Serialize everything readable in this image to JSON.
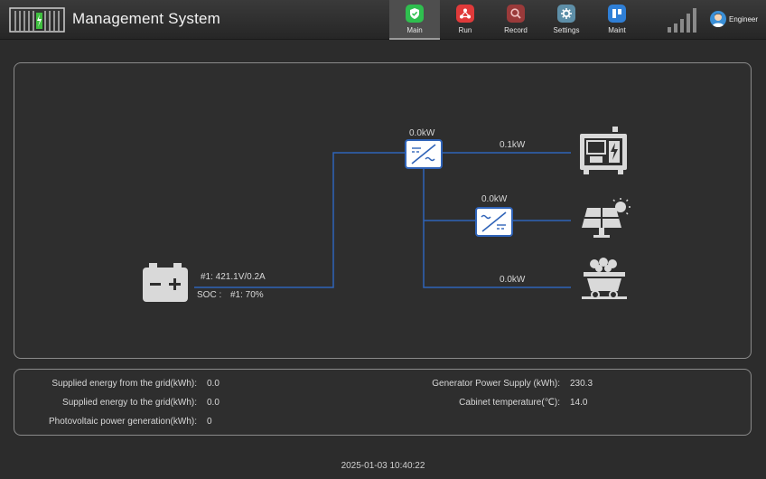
{
  "header": {
    "title": "Management System",
    "nav": [
      {
        "label": "Main",
        "icon": "shield-icon",
        "color": "#2fbf4f",
        "active": true
      },
      {
        "label": "Run",
        "icon": "run-icon",
        "color": "#e03a3a",
        "active": false
      },
      {
        "label": "Record",
        "icon": "record-search-icon",
        "color": "#c94a4a",
        "active": false
      },
      {
        "label": "Settings",
        "icon": "gear-icon",
        "color": "#5e8fa8",
        "active": false
      },
      {
        "label": "Maint",
        "icon": "maint-board-icon",
        "color": "#2f7fd6",
        "active": false
      }
    ],
    "user": "Engineer"
  },
  "diagram": {
    "inverter_top_power": "0.0kW",
    "generator_power": "0.1kW",
    "pv_inverter_power": "0.0kW",
    "load_power": "0.0kW",
    "battery_reading": "#1: 421.1V/0.2A",
    "soc_label": "SOC :",
    "soc_value": "#1: 70%",
    "line_color": "#2f63b8"
  },
  "stats": {
    "left": [
      {
        "label": "Supplied energy from the grid(kWh):",
        "value": "0.0"
      },
      {
        "label": "Supplied energy to the grid(kWh):",
        "value": "0.0"
      },
      {
        "label": "Photovoltaic power generation(kWh):",
        "value": "0"
      }
    ],
    "right": [
      {
        "label": "Generator Power Supply (kWh):",
        "value": "230.3"
      },
      {
        "label": "Cabinet temperature(℃):",
        "value": "14.0"
      }
    ]
  },
  "footer": {
    "datetime": "2025-01-03 10:40:22"
  }
}
